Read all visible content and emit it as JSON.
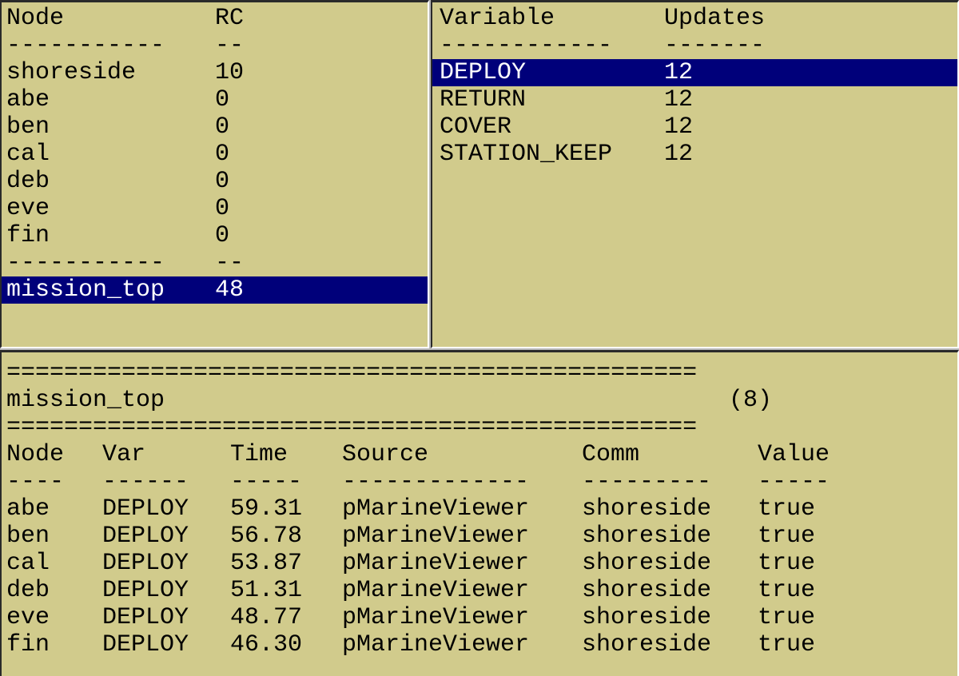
{
  "nodes_pane": {
    "header": {
      "col1": "Node",
      "col2": "RC"
    },
    "separator": {
      "col1": "-----------",
      "col2": "--"
    },
    "rows": [
      {
        "name": "shoreside",
        "rc": "10"
      },
      {
        "name": "abe",
        "rc": "0"
      },
      {
        "name": "ben",
        "rc": "0"
      },
      {
        "name": "cal",
        "rc": "0"
      },
      {
        "name": "deb",
        "rc": "0"
      },
      {
        "name": "eve",
        "rc": "0"
      },
      {
        "name": "fin",
        "rc": "0"
      }
    ],
    "total": {
      "name": "mission_top",
      "rc": "48"
    }
  },
  "vars_pane": {
    "header": {
      "col1": "Variable",
      "col2": "Updates"
    },
    "separator": {
      "col1": "------------",
      "col2": "-------"
    },
    "rows": [
      {
        "name": "DEPLOY",
        "updates": "12"
      },
      {
        "name": "RETURN",
        "updates": "12"
      },
      {
        "name": "COVER",
        "updates": "12"
      },
      {
        "name": "STATION_KEEP",
        "updates": "12"
      }
    ]
  },
  "detail_pane": {
    "rule": "================================================",
    "title": "mission_top",
    "count": "(8)",
    "header": {
      "node": "Node",
      "var": "Var",
      "time": "Time",
      "source": "Source",
      "comm": "Comm",
      "value": "Value"
    },
    "separator": {
      "node": "----",
      "var": "------",
      "time": "-----",
      "source": "-------------",
      "comm": "---------",
      "value": "-----"
    },
    "rows": [
      {
        "node": "abe",
        "var": "DEPLOY",
        "time": "59.31",
        "source": "pMarineViewer",
        "comm": "shoreside",
        "value": "true"
      },
      {
        "node": "ben",
        "var": "DEPLOY",
        "time": "56.78",
        "source": "pMarineViewer",
        "comm": "shoreside",
        "value": "true"
      },
      {
        "node": "cal",
        "var": "DEPLOY",
        "time": "53.87",
        "source": "pMarineViewer",
        "comm": "shoreside",
        "value": "true"
      },
      {
        "node": "deb",
        "var": "DEPLOY",
        "time": "51.31",
        "source": "pMarineViewer",
        "comm": "shoreside",
        "value": "true"
      },
      {
        "node": "eve",
        "var": "DEPLOY",
        "time": "48.77",
        "source": "pMarineViewer",
        "comm": "shoreside",
        "value": "true"
      },
      {
        "node": "fin",
        "var": "DEPLOY",
        "time": "46.30",
        "source": "pMarineViewer",
        "comm": "shoreside",
        "value": "true"
      }
    ]
  },
  "colors": {
    "pane_background": "#d1cb8c",
    "selection_background": "#00007a",
    "selection_text": "#ffffff"
  }
}
